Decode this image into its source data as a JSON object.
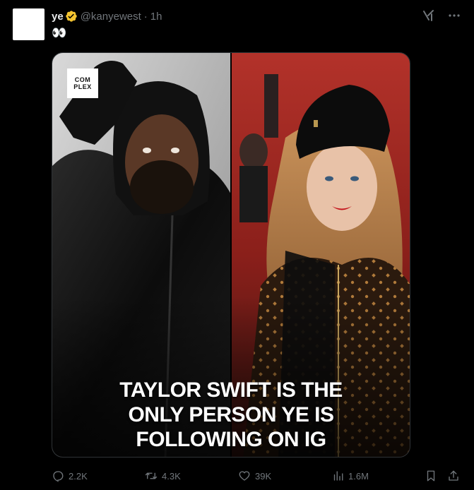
{
  "user": {
    "display_name": "ye",
    "handle": "@kanyewest",
    "separator": "·",
    "time": "1h",
    "verified": true,
    "verified_color": "#f4c430"
  },
  "tweet": {
    "text": "👀"
  },
  "media": {
    "headline_line1": "TAYLOR SWIFT IS THE",
    "headline_line2": "ONLY PERSON YE IS",
    "headline_line3": "FOLLOWING ON IG",
    "logo_line1": "COM",
    "logo_line2": "PLEX"
  },
  "actions": {
    "reply_count": "2.2K",
    "retweet_count": "4.3K",
    "like_count": "39K",
    "views_count": "1.6M"
  },
  "icons": {
    "grok": "grok-icon",
    "more": "more-icon",
    "reply": "reply-icon",
    "retweet": "retweet-icon",
    "like": "heart-icon",
    "views": "views-icon",
    "bookmark": "bookmark-icon",
    "share": "share-icon"
  },
  "colors": {
    "background": "#000000",
    "text_primary": "#e7e9ea",
    "text_secondary": "#71767b"
  }
}
